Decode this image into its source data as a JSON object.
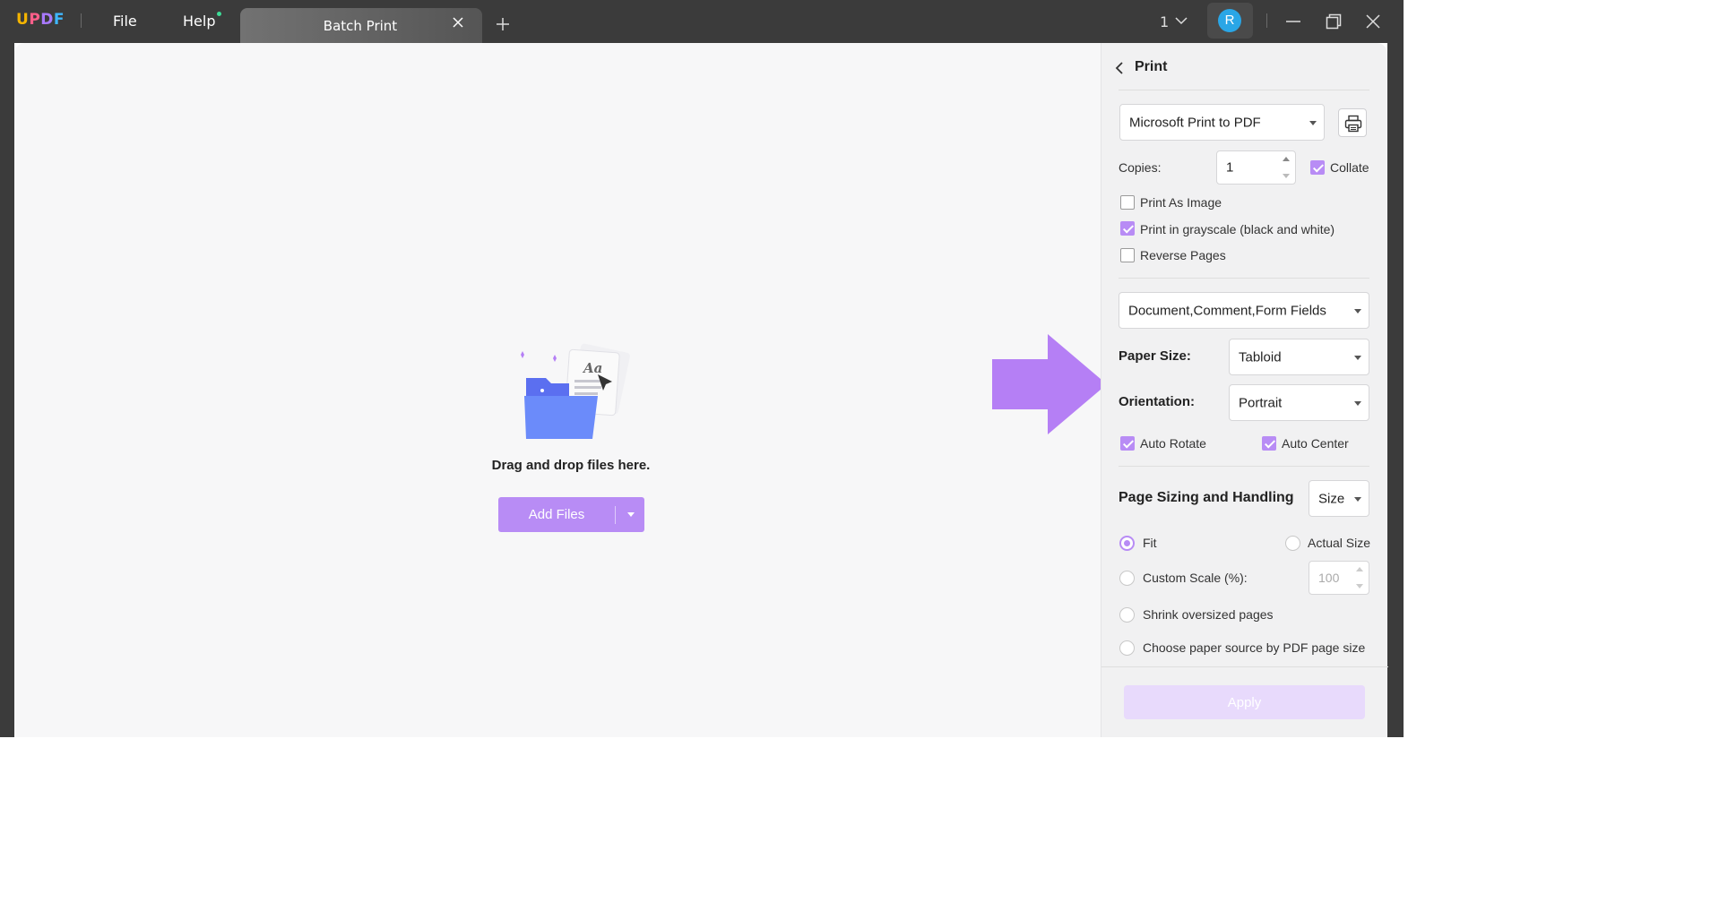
{
  "app": {
    "logo_letters": [
      "U",
      "P",
      "D",
      "F"
    ],
    "menu": {
      "file": "File",
      "help": "Help"
    },
    "tab": {
      "label": "Batch Print"
    },
    "window_count": "1",
    "avatar_initial": "R"
  },
  "main": {
    "drop_text": "Drag and drop files here.",
    "add_files_label": "Add Files",
    "illustration_text": "Aa"
  },
  "print_panel": {
    "title": "Print",
    "printer": "Microsoft Print to PDF",
    "copies_label": "Copies:",
    "copies_value": "1",
    "collate": {
      "label": "Collate",
      "checked": true
    },
    "options": [
      {
        "label": "Print As Image",
        "checked": false
      },
      {
        "label": "Print in grayscale (black and white)",
        "checked": true
      },
      {
        "label": "Reverse Pages",
        "checked": false
      }
    ],
    "content": "Document,Comment,Form Fields",
    "paper_size_label": "Paper Size:",
    "paper_size": "Tabloid",
    "orientation_label": "Orientation:",
    "orientation": "Portrait",
    "auto_rotate": {
      "label": "Auto Rotate",
      "checked": true
    },
    "auto_center": {
      "label": "Auto Center",
      "checked": true
    },
    "page_sizing_label": "Page Sizing and Handling",
    "page_sizing_mode": "Size",
    "fit_label": "Fit",
    "actual_size_label": "Actual Size",
    "custom_scale_label": "Custom Scale (%):",
    "custom_scale_value": "100",
    "shrink_label": "Shrink oversized pages",
    "paper_source_label": "Choose paper source by PDF page size",
    "selected_sizing": "Fit",
    "apply_label": "Apply"
  },
  "colors": {
    "accent": "#b88cf5",
    "titlebar": "#3b3b3b",
    "annotation_arrow": "#b57ff5"
  }
}
